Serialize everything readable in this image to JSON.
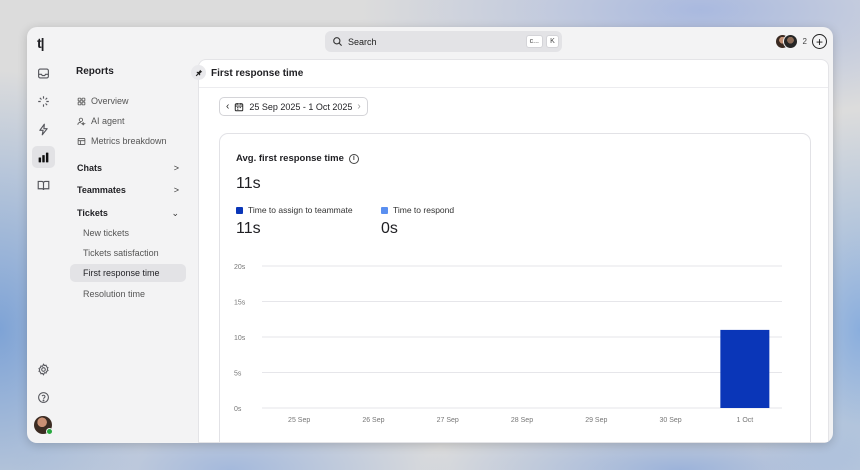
{
  "app": {
    "logo": "t|"
  },
  "rail": {
    "items": [
      {
        "icon": "inbox-icon"
      },
      {
        "icon": "sparkle-icon"
      },
      {
        "icon": "bolt-icon"
      },
      {
        "icon": "bar-chart-icon",
        "active": true
      },
      {
        "icon": "book-icon"
      }
    ],
    "bottom": [
      {
        "icon": "gear-icon"
      },
      {
        "icon": "help-icon"
      }
    ]
  },
  "search": {
    "label": "Search",
    "shortcut_1": "c...",
    "shortcut_2": "K"
  },
  "topbar": {
    "teammate_count": "2",
    "add_label": "+"
  },
  "nav": {
    "title": "Reports",
    "items": [
      {
        "label": "Overview",
        "icon": "grid-icon"
      },
      {
        "label": "AI agent",
        "icon": "ai-agent-icon"
      },
      {
        "label": "Metrics breakdown",
        "icon": "table-icon"
      }
    ],
    "sections": [
      {
        "label": "Chats",
        "chevron": ">"
      },
      {
        "label": "Teammates",
        "chevron": ">"
      },
      {
        "label": "Tickets",
        "chevron": "⌄"
      }
    ],
    "tickets_items": [
      {
        "label": "New tickets"
      },
      {
        "label": "Tickets satisfaction"
      },
      {
        "label": "First response time",
        "active": true
      },
      {
        "label": "Resolution time"
      }
    ]
  },
  "main": {
    "title": "First response time",
    "date_range": "25 Sep 2025 - 1 Oct 2025",
    "card": {
      "title": "Avg. first response time",
      "total": "11s",
      "legend": [
        {
          "label": "Time to assign to teammate",
          "value": "11s",
          "color": "#0a36b8"
        },
        {
          "label": "Time to respond",
          "value": "0s",
          "color": "#5a8ff0"
        }
      ]
    }
  },
  "chart_data": {
    "type": "bar",
    "categories": [
      "25 Sep",
      "26 Sep",
      "27 Sep",
      "28 Sep",
      "29 Sep",
      "30 Sep",
      "1 Oct"
    ],
    "series": [
      {
        "name": "Time to assign to teammate",
        "values": [
          0,
          0,
          0,
          0,
          0,
          0,
          11
        ],
        "color": "#0a36b8"
      },
      {
        "name": "Time to respond",
        "values": [
          0,
          0,
          0,
          0,
          0,
          0,
          0
        ],
        "color": "#5a8ff0"
      }
    ],
    "y_ticks": [
      "0s",
      "5s",
      "10s",
      "15s",
      "20s"
    ],
    "ylim": [
      0,
      20
    ],
    "grid": true,
    "stacked": true
  }
}
